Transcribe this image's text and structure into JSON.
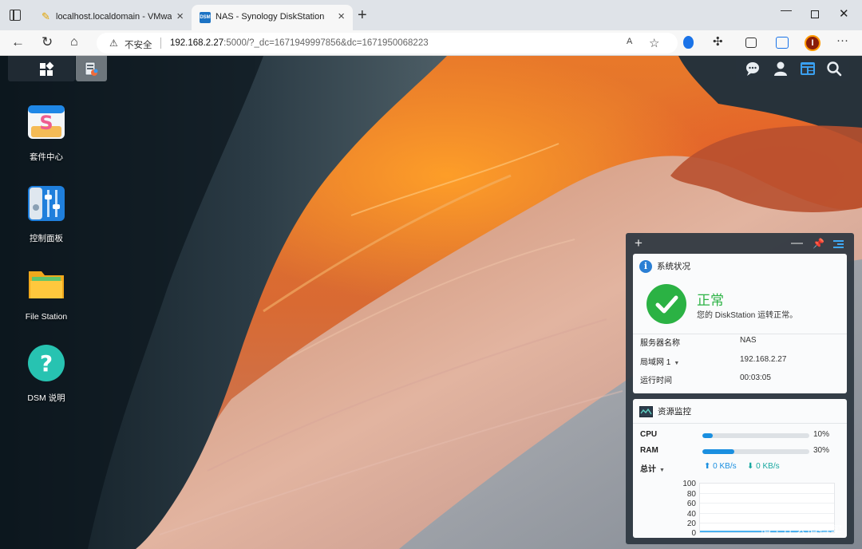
{
  "browser": {
    "tabs": [
      {
        "title": "localhost.localdomain - VMware",
        "active": false
      },
      {
        "title": "NAS - Synology DiskStation",
        "active": true
      }
    ],
    "tab_favicon_dsm": "DSM",
    "security_label": "不安全",
    "url_host": "192.168.2.27",
    "url_rest": ":5000/?_dc=1671949997856&dc=1671950068223",
    "read_aloud": "A",
    "profile_initial": "I"
  },
  "desktop": {
    "apps": [
      {
        "label": "套件中心",
        "icon": "package-center-icon"
      },
      {
        "label": "控制面板",
        "icon": "control-panel-icon"
      },
      {
        "label": "File Station",
        "icon": "folder-icon"
      },
      {
        "label": "DSM 说明",
        "icon": "help-icon"
      }
    ]
  },
  "widgets": {
    "system_health": {
      "title": "系统状况",
      "status": "正常",
      "description": "您的 DiskStation 运转正常。",
      "rows": [
        {
          "key": "服务器名称",
          "value": "NAS"
        },
        {
          "key": "局域网 1",
          "value": "192.168.2.27"
        },
        {
          "key": "运行时间",
          "value": "00:03:05"
        }
      ]
    },
    "resource_monitor": {
      "title": "资源监控",
      "cpu_label": "CPU",
      "cpu_percent": 10,
      "cpu_text": "10%",
      "ram_label": "RAM",
      "ram_percent": 30,
      "ram_text": "30%",
      "total_label": "总计",
      "upload": "0 KB/s",
      "download": "0 KB/s",
      "chart_y_ticks": [
        "100",
        "80",
        "60",
        "40",
        "20",
        "0"
      ]
    }
  },
  "watermark": "值 · 什么值得买",
  "colors": {
    "ok_green": "#2bb244",
    "accent_blue": "#1a8fe0",
    "panel_bg": "#2d3741"
  }
}
